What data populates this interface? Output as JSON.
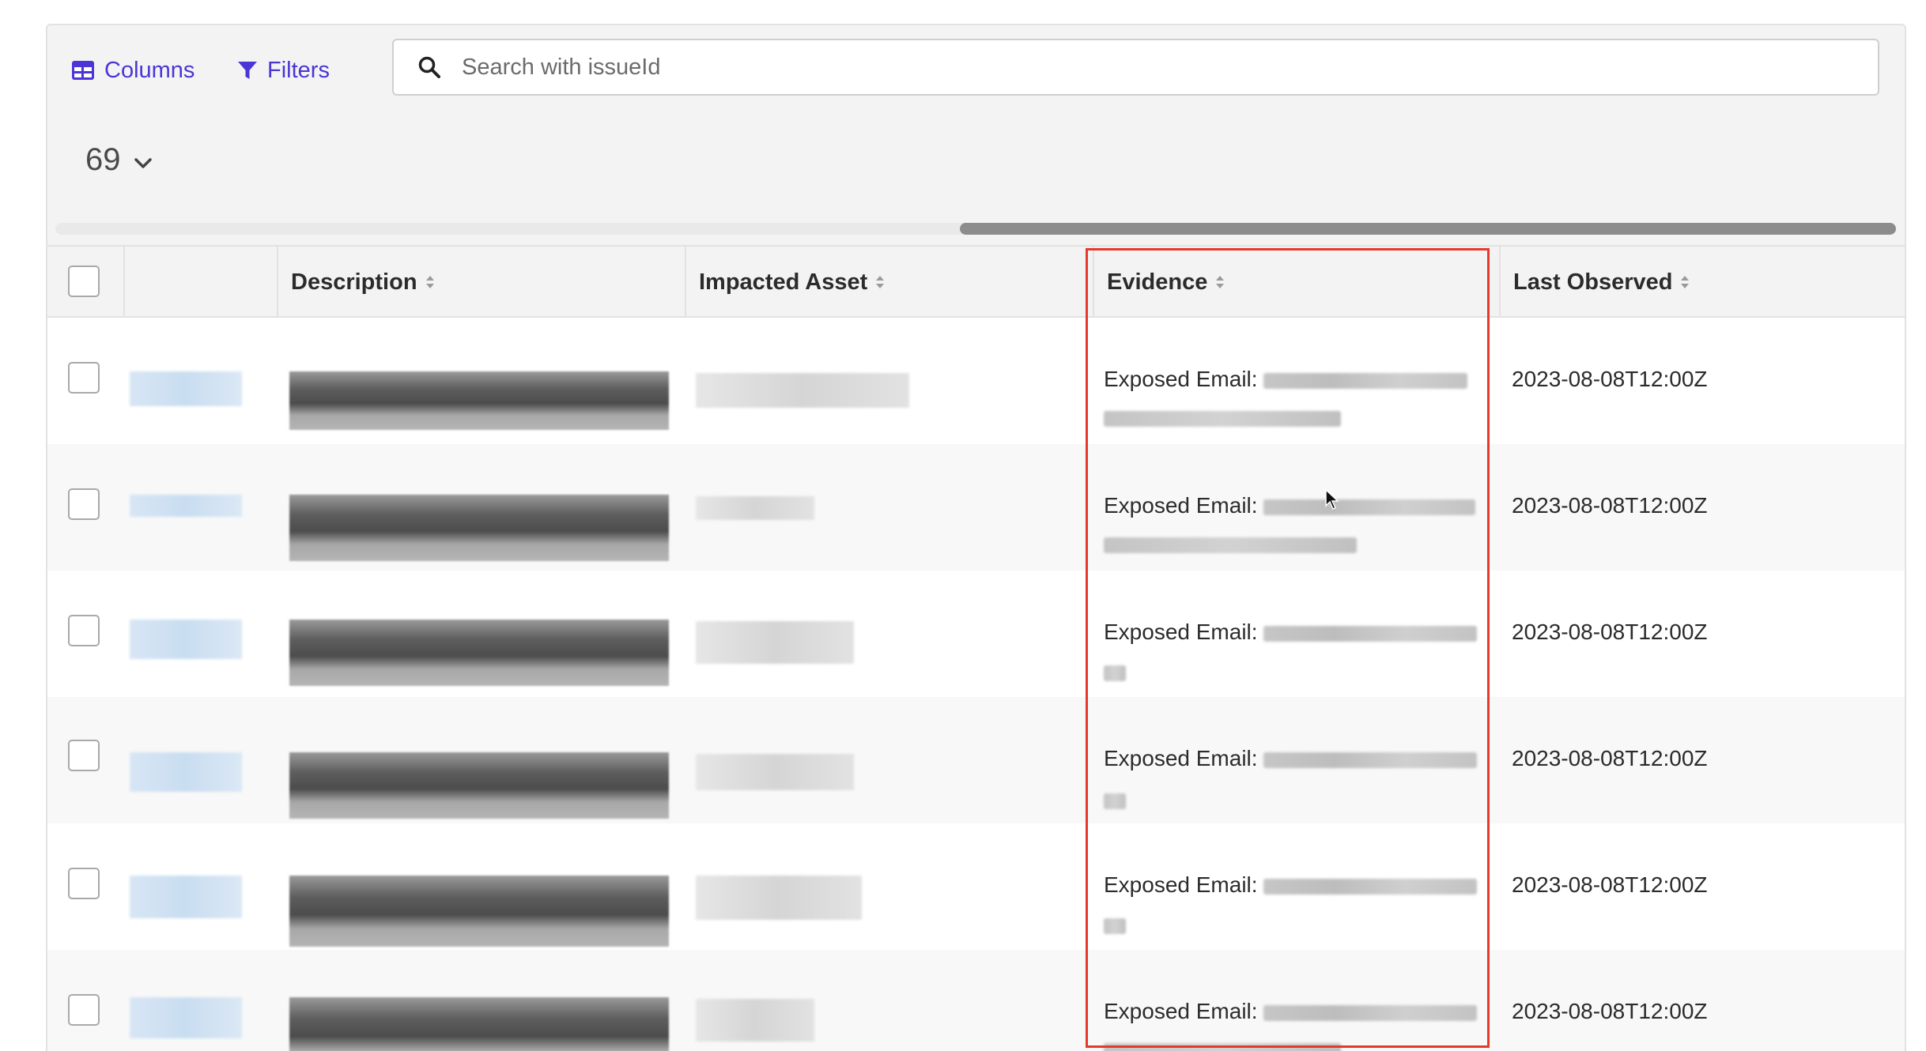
{
  "toolbar": {
    "columns_label": "Columns",
    "filters_label": "Filters",
    "search_placeholder": "Search with issueId",
    "page_size": "69"
  },
  "table": {
    "headers": {
      "description": "Description",
      "impacted_asset": "Impacted Asset",
      "evidence": "Evidence",
      "last_observed": "Last Observed"
    },
    "rows": [
      {
        "evidence_label": "Exposed Email:",
        "last_observed": "2023-08-08T12:00Z"
      },
      {
        "evidence_label": "Exposed Email:",
        "last_observed": "2023-08-08T12:00Z"
      },
      {
        "evidence_label": "Exposed Email:",
        "last_observed": "2023-08-08T12:00Z"
      },
      {
        "evidence_label": "Exposed Email:",
        "last_observed": "2023-08-08T12:00Z"
      },
      {
        "evidence_label": "Exposed Email:",
        "last_observed": "2023-08-08T12:00Z"
      },
      {
        "evidence_label": "Exposed Email:",
        "last_observed": "2023-08-08T12:00Z"
      }
    ]
  },
  "colors": {
    "accent": "#4a35d6",
    "highlight_border": "#e6392b"
  },
  "icons": [
    "table-columns-icon",
    "filter-icon",
    "search-icon",
    "chevron-down-icon",
    "sort-icon"
  ]
}
